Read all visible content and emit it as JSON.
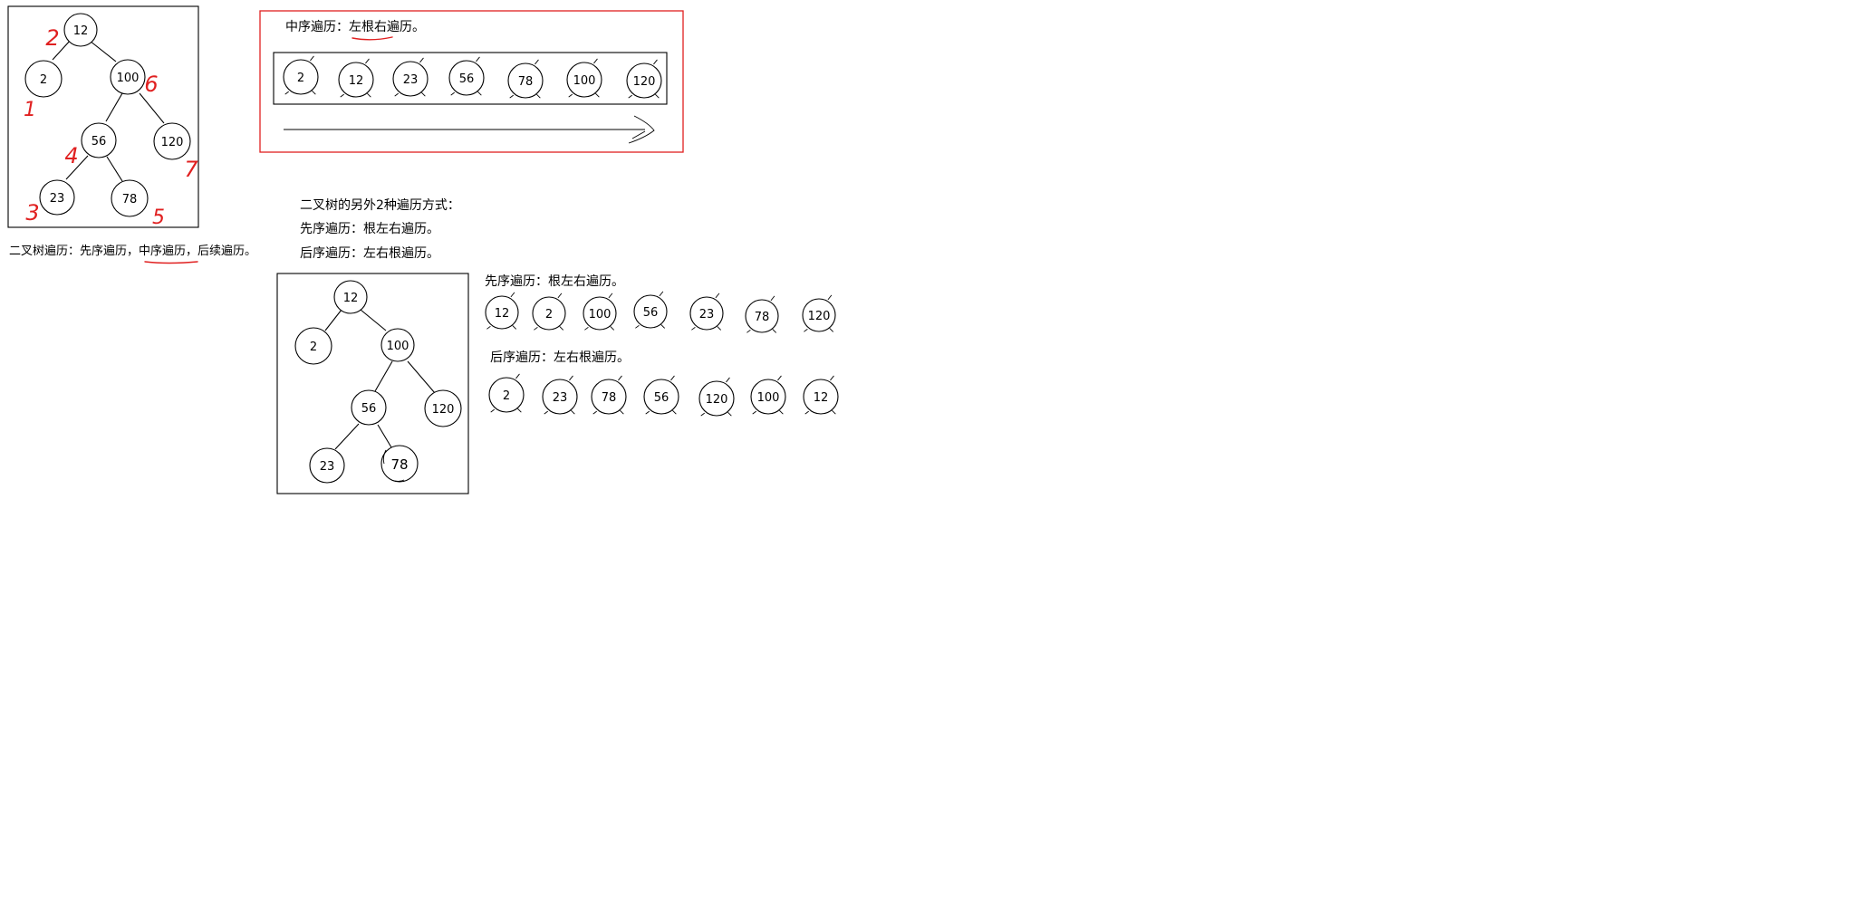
{
  "colors": {
    "ink": "#000000",
    "annotation": "#e02020",
    "background": "#ffffff"
  },
  "tree1": {
    "nodes": [
      "12",
      "2",
      "100",
      "56",
      "120",
      "23",
      "78"
    ],
    "order_marks": [
      "2",
      "1",
      "6",
      "4",
      "7",
      "3",
      "5"
    ],
    "caption": {
      "part1": "二叉树遍历：先序遍历，",
      "part2": "中序遍历",
      "part3": "，后续遍历。"
    }
  },
  "inorder_panel": {
    "title_prefix": "中序遍历：",
    "title_rule": "左根右遍历。",
    "sequence": [
      "2",
      "12",
      "23",
      "56",
      "78",
      "100",
      "120"
    ]
  },
  "other_traversals": {
    "heading": "二叉树的另外2种遍历方式：",
    "preorder_line": "先序遍历：根左右遍历。",
    "postorder_line": "后序遍历：左右根遍历。"
  },
  "tree2": {
    "nodes": [
      "12",
      "2",
      "100",
      "56",
      "120",
      "23",
      "78"
    ]
  },
  "preorder_result": {
    "label": "先序遍历：根左右遍历。",
    "sequence": [
      "12",
      "2",
      "100",
      "56",
      "23",
      "78",
      "120"
    ]
  },
  "postorder_result": {
    "label": "后序遍历：左右根遍历。",
    "sequence": [
      "2",
      "23",
      "78",
      "56",
      "120",
      "100",
      "12"
    ]
  }
}
